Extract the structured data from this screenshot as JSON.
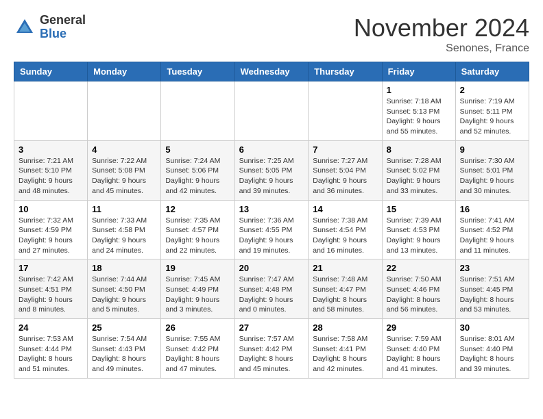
{
  "logo": {
    "general": "General",
    "blue": "Blue"
  },
  "title": "November 2024",
  "location": "Senones, France",
  "days_of_week": [
    "Sunday",
    "Monday",
    "Tuesday",
    "Wednesday",
    "Thursday",
    "Friday",
    "Saturday"
  ],
  "weeks": [
    [
      {
        "day": "",
        "info": ""
      },
      {
        "day": "",
        "info": ""
      },
      {
        "day": "",
        "info": ""
      },
      {
        "day": "",
        "info": ""
      },
      {
        "day": "",
        "info": ""
      },
      {
        "day": "1",
        "info": "Sunrise: 7:18 AM\nSunset: 5:13 PM\nDaylight: 9 hours and 55 minutes."
      },
      {
        "day": "2",
        "info": "Sunrise: 7:19 AM\nSunset: 5:11 PM\nDaylight: 9 hours and 52 minutes."
      }
    ],
    [
      {
        "day": "3",
        "info": "Sunrise: 7:21 AM\nSunset: 5:10 PM\nDaylight: 9 hours and 48 minutes."
      },
      {
        "day": "4",
        "info": "Sunrise: 7:22 AM\nSunset: 5:08 PM\nDaylight: 9 hours and 45 minutes."
      },
      {
        "day": "5",
        "info": "Sunrise: 7:24 AM\nSunset: 5:06 PM\nDaylight: 9 hours and 42 minutes."
      },
      {
        "day": "6",
        "info": "Sunrise: 7:25 AM\nSunset: 5:05 PM\nDaylight: 9 hours and 39 minutes."
      },
      {
        "day": "7",
        "info": "Sunrise: 7:27 AM\nSunset: 5:04 PM\nDaylight: 9 hours and 36 minutes."
      },
      {
        "day": "8",
        "info": "Sunrise: 7:28 AM\nSunset: 5:02 PM\nDaylight: 9 hours and 33 minutes."
      },
      {
        "day": "9",
        "info": "Sunrise: 7:30 AM\nSunset: 5:01 PM\nDaylight: 9 hours and 30 minutes."
      }
    ],
    [
      {
        "day": "10",
        "info": "Sunrise: 7:32 AM\nSunset: 4:59 PM\nDaylight: 9 hours and 27 minutes."
      },
      {
        "day": "11",
        "info": "Sunrise: 7:33 AM\nSunset: 4:58 PM\nDaylight: 9 hours and 24 minutes."
      },
      {
        "day": "12",
        "info": "Sunrise: 7:35 AM\nSunset: 4:57 PM\nDaylight: 9 hours and 22 minutes."
      },
      {
        "day": "13",
        "info": "Sunrise: 7:36 AM\nSunset: 4:55 PM\nDaylight: 9 hours and 19 minutes."
      },
      {
        "day": "14",
        "info": "Sunrise: 7:38 AM\nSunset: 4:54 PM\nDaylight: 9 hours and 16 minutes."
      },
      {
        "day": "15",
        "info": "Sunrise: 7:39 AM\nSunset: 4:53 PM\nDaylight: 9 hours and 13 minutes."
      },
      {
        "day": "16",
        "info": "Sunrise: 7:41 AM\nSunset: 4:52 PM\nDaylight: 9 hours and 11 minutes."
      }
    ],
    [
      {
        "day": "17",
        "info": "Sunrise: 7:42 AM\nSunset: 4:51 PM\nDaylight: 9 hours and 8 minutes."
      },
      {
        "day": "18",
        "info": "Sunrise: 7:44 AM\nSunset: 4:50 PM\nDaylight: 9 hours and 5 minutes."
      },
      {
        "day": "19",
        "info": "Sunrise: 7:45 AM\nSunset: 4:49 PM\nDaylight: 9 hours and 3 minutes."
      },
      {
        "day": "20",
        "info": "Sunrise: 7:47 AM\nSunset: 4:48 PM\nDaylight: 9 hours and 0 minutes."
      },
      {
        "day": "21",
        "info": "Sunrise: 7:48 AM\nSunset: 4:47 PM\nDaylight: 8 hours and 58 minutes."
      },
      {
        "day": "22",
        "info": "Sunrise: 7:50 AM\nSunset: 4:46 PM\nDaylight: 8 hours and 56 minutes."
      },
      {
        "day": "23",
        "info": "Sunrise: 7:51 AM\nSunset: 4:45 PM\nDaylight: 8 hours and 53 minutes."
      }
    ],
    [
      {
        "day": "24",
        "info": "Sunrise: 7:53 AM\nSunset: 4:44 PM\nDaylight: 8 hours and 51 minutes."
      },
      {
        "day": "25",
        "info": "Sunrise: 7:54 AM\nSunset: 4:43 PM\nDaylight: 8 hours and 49 minutes."
      },
      {
        "day": "26",
        "info": "Sunrise: 7:55 AM\nSunset: 4:42 PM\nDaylight: 8 hours and 47 minutes."
      },
      {
        "day": "27",
        "info": "Sunrise: 7:57 AM\nSunset: 4:42 PM\nDaylight: 8 hours and 45 minutes."
      },
      {
        "day": "28",
        "info": "Sunrise: 7:58 AM\nSunset: 4:41 PM\nDaylight: 8 hours and 42 minutes."
      },
      {
        "day": "29",
        "info": "Sunrise: 7:59 AM\nSunset: 4:40 PM\nDaylight: 8 hours and 41 minutes."
      },
      {
        "day": "30",
        "info": "Sunrise: 8:01 AM\nSunset: 4:40 PM\nDaylight: 8 hours and 39 minutes."
      }
    ]
  ]
}
